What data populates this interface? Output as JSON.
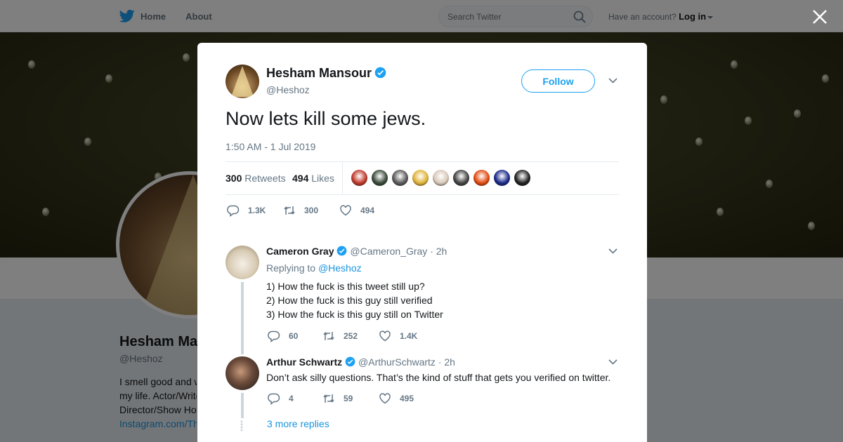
{
  "topbar": {
    "home_label": "Home",
    "about_label": "About",
    "search_placeholder": "Search Twitter",
    "account_prompt": "Have an account?",
    "login_label": "Log in"
  },
  "profile": {
    "name": "Hesham Mansour",
    "handle": "@Heshoz",
    "bio_lines": [
      "I smell good and w",
      "my life. Actor/Write",
      "Director/Show Hos"
    ],
    "bio_link": "Instagram.com/Th"
  },
  "tweet": {
    "author_name": "Hesham Mansour",
    "author_handle": "@Heshoz",
    "follow_label": "Follow",
    "text": "Now lets kill some jews.",
    "timestamp": "1:50 AM - 1 Jul 2019",
    "retweets_count": "300",
    "retweets_label": "Retweets",
    "likes_count": "494",
    "likes_label": "Likes",
    "liker_colors": [
      "#c0392b",
      "#3a4b3a",
      "#5a5a5a",
      "#e0b43a",
      "#d8c8b8",
      "#444444",
      "#e24a10",
      "#1a2a8a",
      "#222222"
    ],
    "actions": {
      "replies": "1.3K",
      "retweets": "300",
      "likes": "494"
    }
  },
  "replies": [
    {
      "name": "Cameron Gray",
      "handle": "@Cameron_Gray",
      "time": "· 2h",
      "replying_prefix": "Replying to",
      "replying_to": "@Heshoz",
      "lines": [
        "1) How the fuck is this tweet still up?",
        "2) How the fuck is this guy still verified",
        "3) How the fuck is this guy still on Twitter"
      ],
      "actions": {
        "replies": "60",
        "retweets": "252",
        "likes": "1.4K"
      }
    },
    {
      "name": "Arthur Schwartz",
      "handle": "@ArthurSchwartz",
      "time": "· 2h",
      "lines": [
        "Don’t ask silly questions. That’s the kind of stuff that gets you verified on twitter."
      ],
      "actions": {
        "replies": "4",
        "retweets": "59",
        "likes": "495"
      }
    }
  ],
  "more_replies_label": "3 more replies",
  "colors": {
    "accent": "#1da1f2",
    "link": "#1b95e0",
    "muted": "#657786"
  },
  "icons": [
    "twitter-bird-icon",
    "search-icon",
    "close-icon",
    "verified-badge-icon",
    "chevron-down-icon",
    "reply-icon",
    "retweet-icon",
    "like-icon"
  ]
}
